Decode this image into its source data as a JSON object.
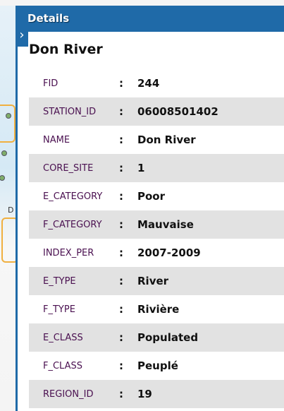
{
  "header": {
    "title": "Details"
  },
  "feature_title": "Don River",
  "separator": ":",
  "map_label": "D",
  "attributes": [
    {
      "key": "FID",
      "value": "244"
    },
    {
      "key": "STATION_ID",
      "value": "06008501402"
    },
    {
      "key": "NAME",
      "value": "Don River"
    },
    {
      "key": "CORE_SITE",
      "value": "1"
    },
    {
      "key": "E_CATEGORY",
      "value": "Poor"
    },
    {
      "key": "F_CATEGORY",
      "value": "Mauvaise"
    },
    {
      "key": "INDEX_PER",
      "value": "2007-2009"
    },
    {
      "key": "E_TYPE",
      "value": "River"
    },
    {
      "key": "F_TYPE",
      "value": "Rivière"
    },
    {
      "key": "E_CLASS",
      "value": "Populated"
    },
    {
      "key": "F_CLASS",
      "value": "Peuplé"
    },
    {
      "key": "REGION_ID",
      "value": "19"
    }
  ]
}
